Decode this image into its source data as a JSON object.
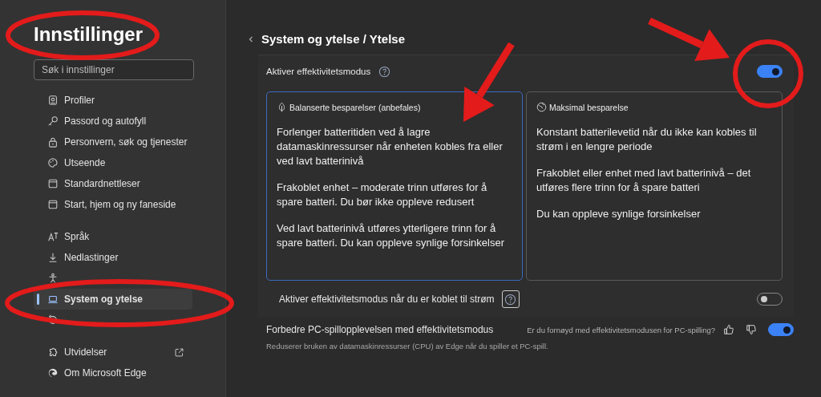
{
  "sidebar": {
    "title": "Innstillinger",
    "search": {
      "placeholder": "Søk i innstillinger"
    },
    "groups": [
      {
        "items": [
          {
            "label": "Profiler",
            "selected": false
          },
          {
            "label": "Passord og autofyll",
            "selected": false
          },
          {
            "label": "Personvern, søk og tjenester",
            "selected": false
          },
          {
            "label": "Utseende",
            "selected": false
          },
          {
            "label": "Standardnettleser",
            "selected": false
          },
          {
            "label": "Start, hjem og ny faneside",
            "selected": false
          }
        ]
      },
      {
        "items": [
          {
            "label": "Språk",
            "selected": false
          },
          {
            "label": "Nedlastinger",
            "selected": false
          },
          {
            "selected": false
          },
          {
            "label": "System og ytelse",
            "selected": true
          },
          {
            "selected": false
          }
        ]
      },
      {
        "items": [
          {
            "label": "Utvidelser",
            "selected": false,
            "external": true
          },
          {
            "label": "Om Microsoft Edge",
            "selected": false
          }
        ]
      }
    ]
  },
  "main": {
    "breadcrumb": "System og ytelse / Ytelse",
    "efficiency": {
      "label": "Aktiver effektivitetsmodus",
      "on": true,
      "options": [
        {
          "title": "Balanserte besparelser (anbefales)",
          "selected": true,
          "paragraphs": [
            "Forlenger batteritiden ved å lagre datamaskinressurser når enheten kobles fra eller ved lavt batterinivå",
            "Frakoblet enhet – moderate trinn utføres for å spare batteri. Du bør ikke oppleve redusert",
            "Ved lavt batterinivå utføres ytterligere trinn for å spare batteri. Du kan oppleve synlige forsinkelser"
          ]
        },
        {
          "title": "Maksimal besparelse",
          "selected": false,
          "paragraphs": [
            "Konstant batterilevetid når du ikke kan kobles til strøm i en lengre periode",
            "Frakoblet eller enhet med lavt batterinivå – det utføres flere trinn for å spare batteri",
            "Du kan oppleve synlige forsinkelser"
          ]
        }
      ],
      "plugged": {
        "label": "Aktiver effektivitetsmodus når du er koblet til strøm",
        "on": false
      }
    },
    "gaming": {
      "label": "Forbedre PC-spillopplevelsen med effektivitetsmodus",
      "feedback": "Er du fornøyd med effektivitetsmodusen for PC-spilling?",
      "on": true,
      "description": "Reduserer bruken av datamaskinressurser (CPU) av Edge når du spiller et PC-spill."
    }
  },
  "annotations": [
    {
      "kind": "ellipse"
    },
    {
      "kind": "ellipse"
    },
    {
      "kind": "ellipse"
    },
    {
      "kind": "arrow"
    },
    {
      "kind": "arrow"
    }
  ]
}
